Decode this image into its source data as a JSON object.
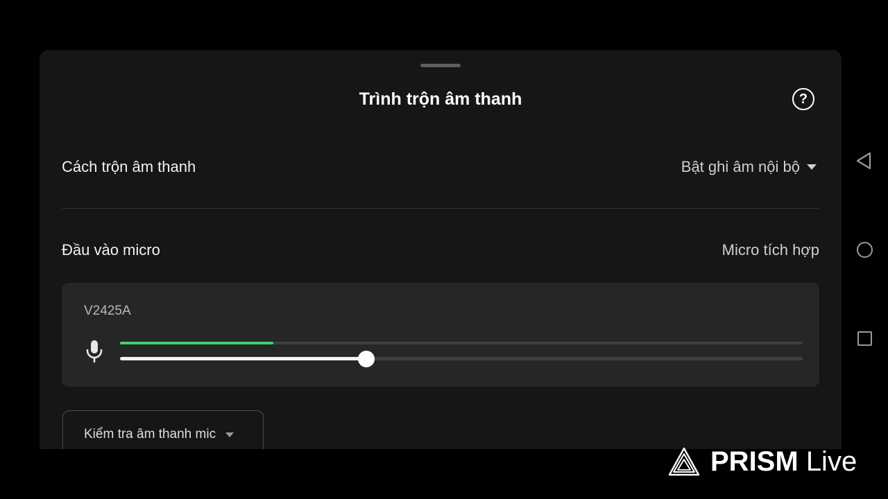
{
  "mixer_sheet": {
    "title": "Trình trộn âm thanh",
    "help_icon": "help-circle-icon",
    "help_glyph": "?",
    "mix_method": {
      "label": "Cách trộn âm thanh",
      "value": "Bật ghi âm nội bộ"
    },
    "mic_input": {
      "label": "Đầu vào micro",
      "value": "Micro tích hợp"
    },
    "device": {
      "name": "V2425A",
      "mic_icon": "microphone-icon",
      "level_fraction": 0.225,
      "volume_fraction": 0.361
    },
    "mic_test": {
      "label": "Kiểm tra âm thanh mic"
    }
  },
  "nav_bar": {
    "back_icon": "back-triangle-icon",
    "home_icon": "home-circle-icon",
    "recent_icon": "recent-square-icon"
  },
  "watermark": {
    "logo_icon": "prism-logo-icon",
    "brand_bold": "PRISM",
    "brand_light": "Live"
  },
  "colors": {
    "level_green": "#3fd36b",
    "sheet_bg": "#161616",
    "card_bg": "#262626"
  }
}
